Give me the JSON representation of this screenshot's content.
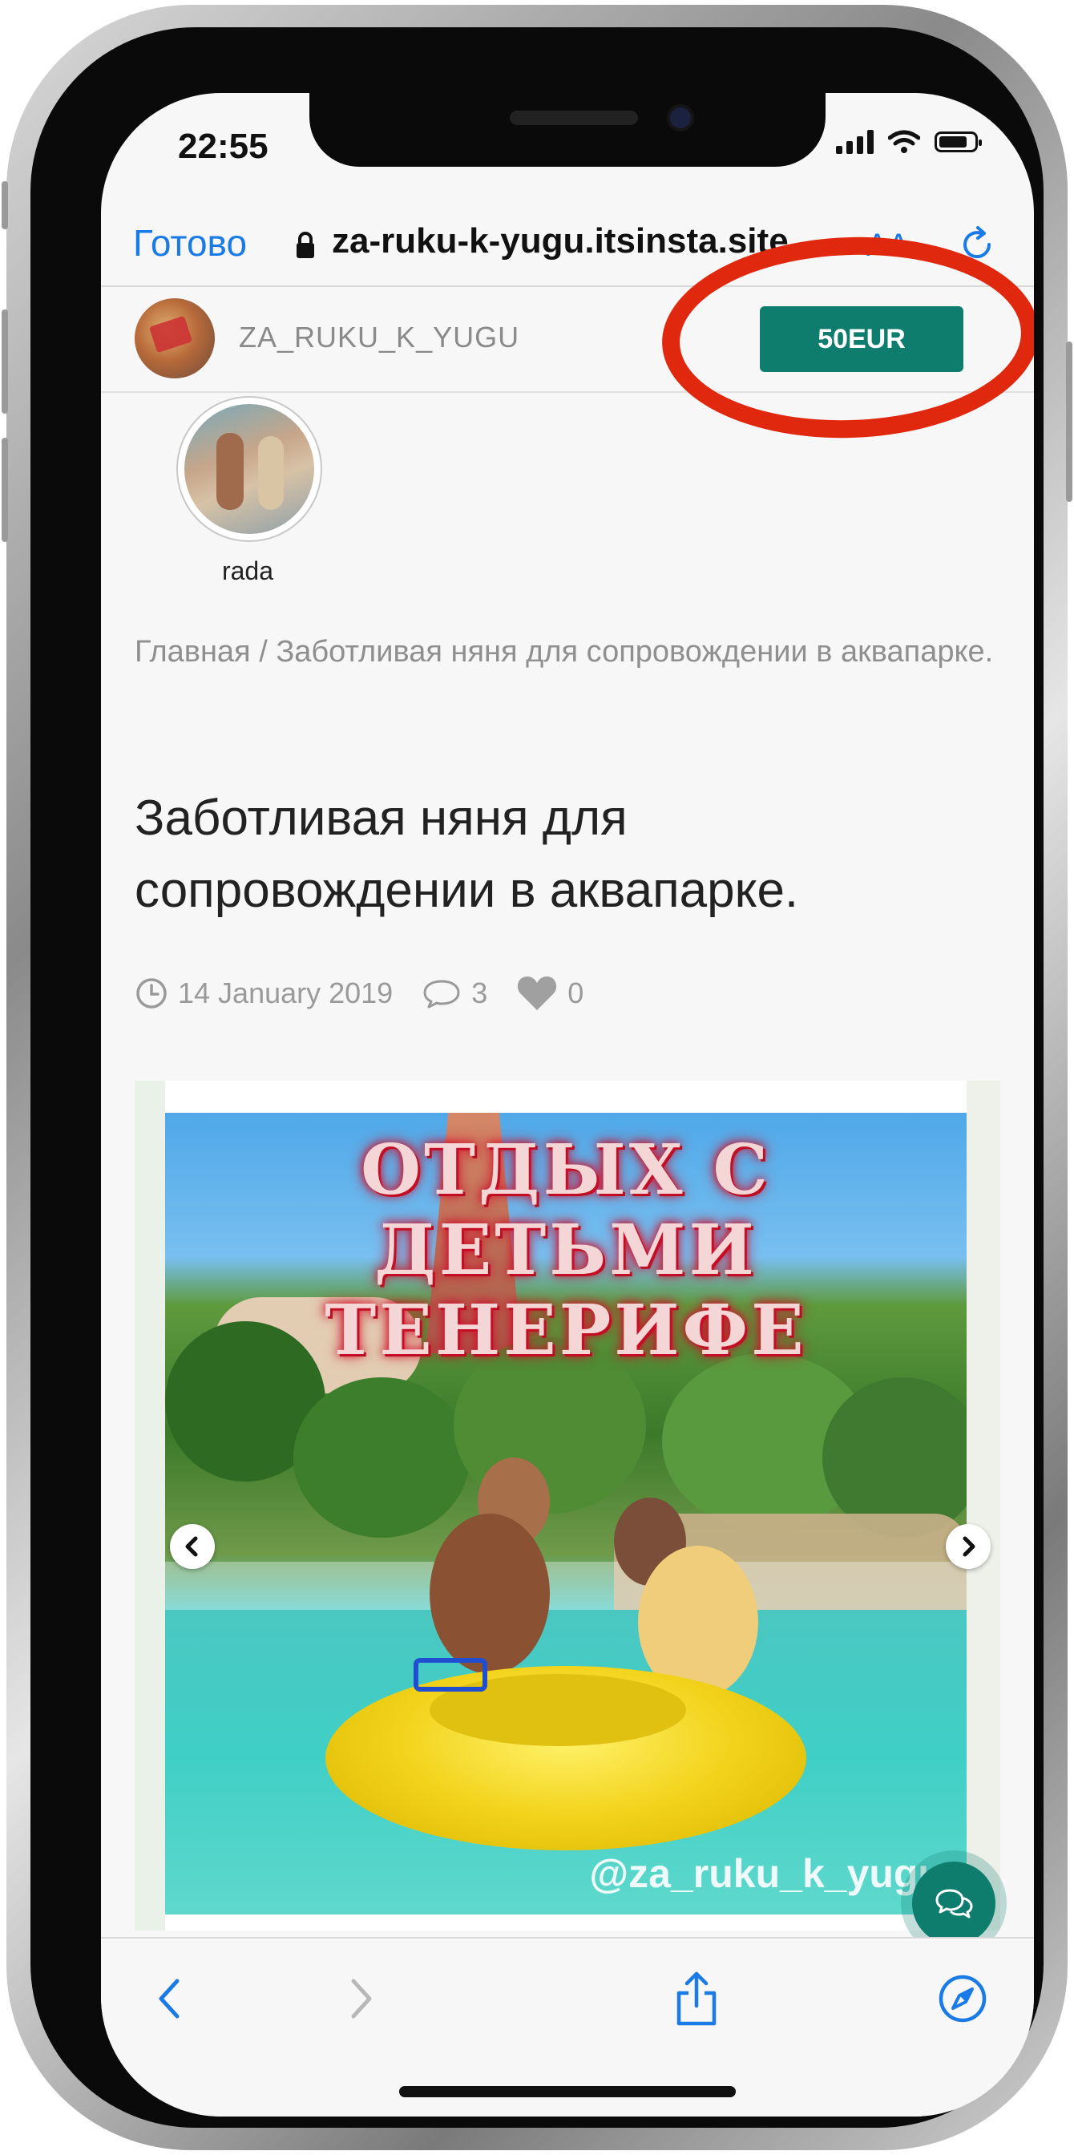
{
  "status_bar": {
    "time": "22:55"
  },
  "browser": {
    "done_label": "Готово",
    "url": "za-ruku-k-yugu.itsinsta.site",
    "text_size_label": "AA"
  },
  "site_header": {
    "site_name": "ZA_RUKU_K_YUGU",
    "price_label": "50EUR"
  },
  "story": {
    "label": "rada"
  },
  "breadcrumb": {
    "home": "Главная",
    "separator": " / ",
    "current": "Заботливая няня для сопровождении в аквапарке."
  },
  "post": {
    "title": "Заботливая няня для сопровождении в аквапарке.",
    "date": "14 January 2019",
    "comments": "3",
    "likes": "0"
  },
  "slide": {
    "headline_line1": "ОТДЫХ С ДЕТЬМИ",
    "headline_line2": "ТЕНЕРИФЕ",
    "watermark": "@za_ruku_k_yugu"
  },
  "colors": {
    "accent": "#0f7d6e",
    "link": "#1a7ae6",
    "annotation": "#e0280f"
  },
  "icons": [
    "lock-icon",
    "reload-icon",
    "clock-icon",
    "comment-icon",
    "heart-icon",
    "chat-icon",
    "back-icon",
    "forward-icon",
    "share-icon",
    "compass-icon"
  ]
}
